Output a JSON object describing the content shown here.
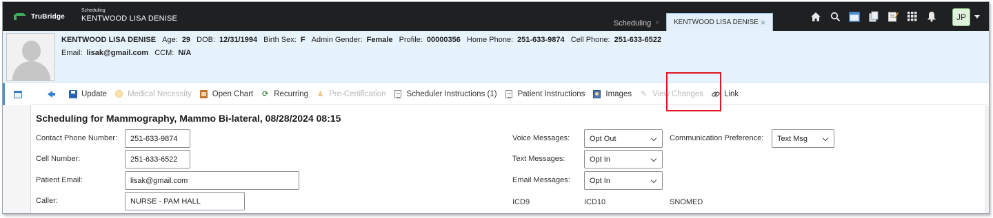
{
  "topbar": {
    "logo_text": "TruBridge",
    "context_sub": "Scheduling",
    "context_name": "KENTWOOD LISA DENISE",
    "tabs": [
      {
        "label": "Scheduling",
        "close": "×"
      },
      {
        "label": "KENTWOOD LISA DENISE",
        "close": "×"
      }
    ],
    "icons": [
      "home-icon",
      "search-icon",
      "window-icon",
      "documents-icon",
      "notes-icon",
      "apps-grid-icon",
      "bell-icon"
    ],
    "user_initials": "JP"
  },
  "patient": {
    "name": "KENTWOOD LISA DENISE",
    "age_label": "Age:",
    "age": "29",
    "dob_label": "DOB:",
    "dob": "12/31/1994",
    "birth_sex_label": "Birth Sex:",
    "birth_sex": "F",
    "admin_gender_label": "Admin Gender:",
    "admin_gender": "Female",
    "profile_label": "Profile:",
    "profile": "00000356",
    "home_phone_label": "Home Phone:",
    "home_phone": "251-633-9874",
    "cell_phone_label": "Cell Phone:",
    "cell_phone": "251-633-6522",
    "email_label": "Email:",
    "email": "lisak@gmail.com",
    "ccm_label": "CCM:",
    "ccm": "N/A"
  },
  "toolbar": {
    "update": "Update",
    "medical_necessity": "Medical Necessity",
    "open_chart": "Open Chart",
    "recurring": "Recurring",
    "pre_certification": "Pre-Certification",
    "scheduler_instructions": "Scheduler Instructions (1)",
    "patient_instructions": "Patient Instructions",
    "images": "Images",
    "view_changes": "View Changes",
    "link": "Link"
  },
  "form": {
    "title": "Scheduling for Mammography, Mammo Bi-lateral, 08/28/2024 08:15",
    "contact_phone_label": "Contact Phone Number:",
    "contact_phone": "251-633-9874",
    "cell_number_label": "Cell Number:",
    "cell_number": "251-633-6522",
    "patient_email_label": "Patient Email:",
    "patient_email": "lisak@gmail.com",
    "caller_label": "Caller:",
    "caller": "NURSE - PAM HALL",
    "voice_messages_label": "Voice Messages:",
    "voice_messages": "Opt Out",
    "text_messages_label": "Text Messages:",
    "text_messages": "Opt In",
    "email_messages_label": "Email Messages:",
    "email_messages": "Opt In",
    "communication_preference_label": "Communication Preference:",
    "communication_preference": "Text Msg",
    "codes": [
      "ICD9",
      "ICD10",
      "SNOMED"
    ]
  },
  "colors": {
    "topbar_bg": "#1f2022",
    "banner_bg": "#e6f2fc",
    "brand_green": "#3fae5b",
    "highlight": "#e0161e"
  }
}
